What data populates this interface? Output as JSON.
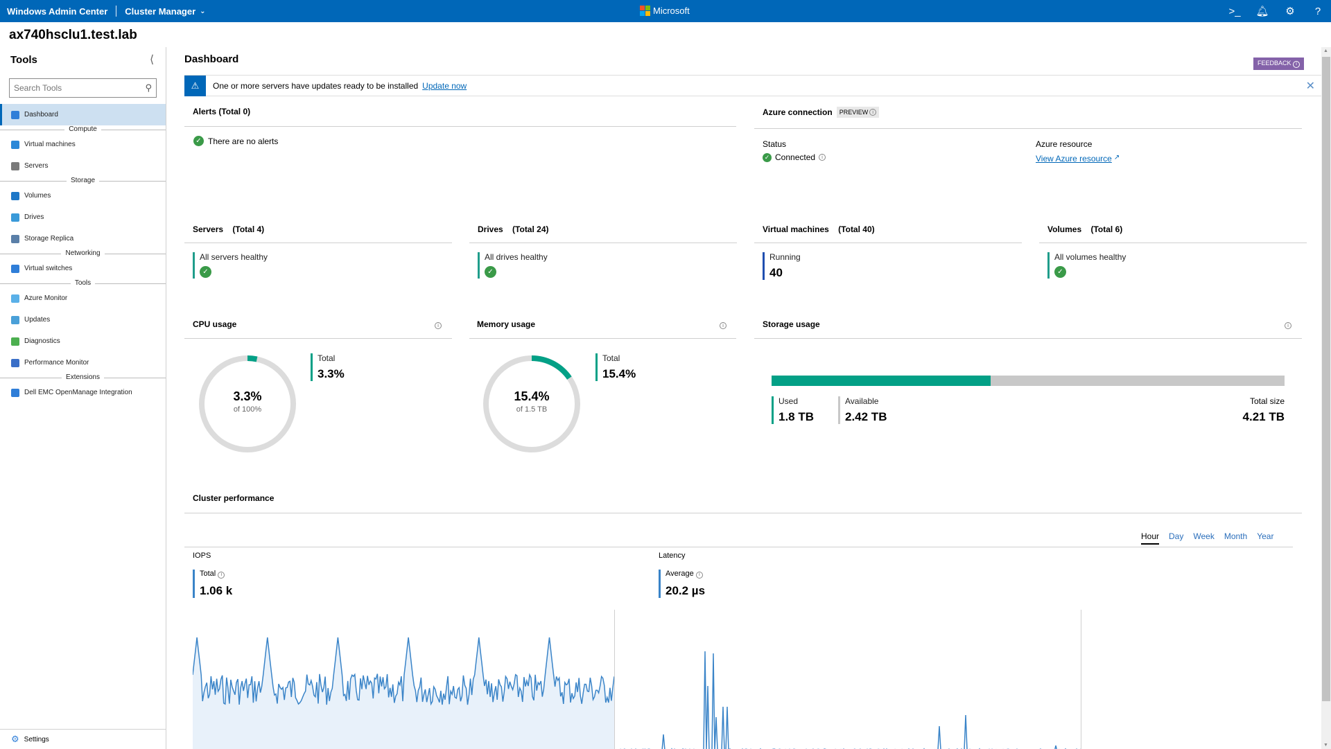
{
  "topbar": {
    "brand": "Windows Admin Center",
    "context": "Cluster Manager",
    "vendor": "Microsoft",
    "icons": [
      "powershell-icon",
      "notifications-icon",
      "settings-icon",
      "help-icon"
    ]
  },
  "connection": {
    "name": "ax740hsclu1.test.lab"
  },
  "sidebar": {
    "title": "Tools",
    "search_placeholder": "Search Tools",
    "items": [
      {
        "type": "item",
        "label": "Dashboard",
        "icon": "home-icon",
        "color": "#2f7ed8",
        "active": true
      },
      {
        "type": "group",
        "label": "Compute"
      },
      {
        "type": "item",
        "label": "Virtual machines",
        "icon": "virtual-machine-icon",
        "color": "#2b88d8"
      },
      {
        "type": "item",
        "label": "Servers",
        "icon": "server-icon",
        "color": "#7a7a7a"
      },
      {
        "type": "group",
        "label": "Storage"
      },
      {
        "type": "item",
        "label": "Volumes",
        "icon": "volumes-icon",
        "color": "#1f78c8"
      },
      {
        "type": "item",
        "label": "Drives",
        "icon": "drive-icon",
        "color": "#3a9ad9"
      },
      {
        "type": "item",
        "label": "Storage Replica",
        "icon": "storage-replica-icon",
        "color": "#5a7fa8"
      },
      {
        "type": "group",
        "label": "Networking"
      },
      {
        "type": "item",
        "label": "Virtual switches",
        "icon": "virtual-switch-icon",
        "color": "#2f7ed8"
      },
      {
        "type": "group",
        "label": "Tools"
      },
      {
        "type": "item",
        "label": "Azure Monitor",
        "icon": "azure-monitor-icon",
        "color": "#5ab0e8"
      },
      {
        "type": "item",
        "label": "Updates",
        "icon": "updates-icon",
        "color": "#4aa0d8"
      },
      {
        "type": "item",
        "label": "Diagnostics",
        "icon": "diagnostics-icon",
        "color": "#4caf50"
      },
      {
        "type": "item",
        "label": "Performance Monitor",
        "icon": "performance-monitor-icon",
        "color": "#3a6fc8"
      },
      {
        "type": "group",
        "label": "Extensions"
      },
      {
        "type": "item",
        "label": "Dell EMC OpenManage Integration",
        "icon": "dell-emc-icon",
        "color": "#2f7ed8"
      }
    ],
    "settings_label": "Settings"
  },
  "main": {
    "title": "Dashboard",
    "feedback_label": "FEEDBACK",
    "banner": {
      "message": "One or more servers have updates ready to be installed",
      "link": "Update now"
    },
    "alerts": {
      "title": "Alerts (Total 0)",
      "message": "There are no alerts"
    },
    "azure": {
      "title": "Azure connection",
      "badge": "PREVIEW",
      "status_label": "Status",
      "status_value": "Connected",
      "resource_label": "Azure resource",
      "resource_link": "View Azure resource"
    },
    "summary": [
      {
        "title": "Servers",
        "total": "(Total 4)",
        "label": "All servers healthy",
        "kind": "healthy"
      },
      {
        "title": "Drives",
        "total": "(Total 24)",
        "label": "All drives healthy",
        "kind": "healthy"
      },
      {
        "title": "Virtual machines",
        "total": "(Total 40)",
        "label": "Running",
        "value": "40",
        "kind": "count"
      },
      {
        "title": "Volumes",
        "total": "(Total 6)",
        "label": "All volumes healthy",
        "kind": "healthy"
      }
    ],
    "cpu": {
      "title": "CPU usage",
      "percent": 3.3,
      "value": "3.3%",
      "sub": "of 100%",
      "total_label": "Total",
      "total_value": "3.3%"
    },
    "memory": {
      "title": "Memory usage",
      "percent": 15.4,
      "value": "15.4%",
      "sub": "of 1.5 TB",
      "total_label": "Total",
      "total_value": "15.4%"
    },
    "storage": {
      "title": "Storage usage",
      "used_fraction": 0.427,
      "used_label": "Used",
      "used_value": "1.8 TB",
      "available_label": "Available",
      "available_value": "2.42 TB",
      "total_label": "Total size",
      "total_value": "4.21 TB"
    },
    "performance": {
      "title": "Cluster performance",
      "tabs": [
        "Hour",
        "Day",
        "Week",
        "Month",
        "Year"
      ],
      "active_tab": "Hour",
      "iops": {
        "title": "IOPS",
        "stat_label": "Total",
        "stat_value": "1.06 k"
      },
      "latency": {
        "title": "Latency",
        "stat_label": "Average",
        "stat_value": "20.2 µs"
      }
    }
  },
  "colors": {
    "brand": "#0067b8",
    "accent_teal": "#03a086",
    "ok_green": "#3a9a48",
    "vm_blue": "#1f4fb0",
    "feedback_purple": "#8462a9",
    "chart_line": "#3a84c8",
    "chart_fill": "#e8f1fa"
  }
}
